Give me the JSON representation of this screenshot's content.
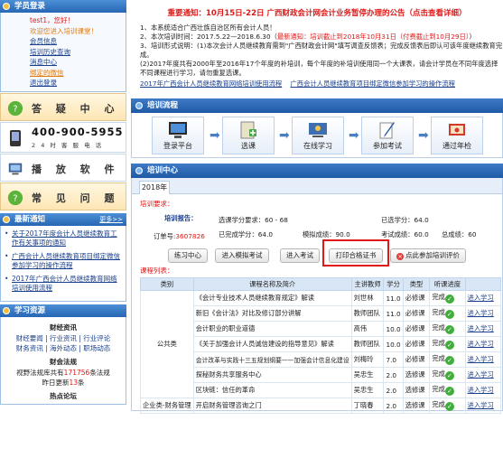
{
  "sidebar": {
    "login_title": "学员登录",
    "user_greeting": "test1，您好！",
    "welcome": "欢迎您进入培训课堂！",
    "menu": [
      "会员信息",
      "培训历史查询",
      "消息中心",
      "绑定的微信",
      "退出登录"
    ],
    "qa_label": "答 疑 中 心",
    "phone": "400-900-5955",
    "phone_sub": "2 4 时 客 服 电 话",
    "software_label": "播 放 软 件",
    "faq_label": "常 见 问 题",
    "news_title": "最新通知",
    "news_more": "更多>>",
    "news": [
      "关于2017年度会计人员继续教育工作有关事项的通知",
      "广西会计人员继续教育项目绑定微信参加学习的操作流程",
      "2017年广西会计人员继续教育网络培训使用流程"
    ],
    "resources_title": "学习资源",
    "res_finance_title": "财经资讯",
    "res_finance_links": [
      "财经要闻 | 行业资讯 | 行业评论",
      "财务资讯 | 海外动态 | 职场动态"
    ],
    "res_law_title": "财会法规",
    "res_law_text_a": "视野法规库共有",
    "res_law_count": "171756",
    "res_law_text_b": "条法规",
    "res_law_updated_a": "昨日更新",
    "res_law_updated_count": "13",
    "res_law_updated_b": "条",
    "res_forum_title": "热点论坛"
  },
  "main": {
    "announcement": "重要通知：10月15日-22日 广西财政会计网会计业务暂停办理的公告（点击查看详细）",
    "info": [
      "1、本系统适合广西壮族自治区所有会计人员！",
      "2、本次培训时间：2017.5.22—2018.6.30（",
      "3、培训形式说明：(1)本次会计人员继续教育需到\"广西财政会计网\"填写调查反馈表；完成反馈表后即认可该年度继续教育完成。",
      "(2)2017年度共有2000年至2016年17个年度的补培训，每个年度的补培训使用同一个大课表，请会计学员在不同年度选择不同课程进行学习，请勿重复选课。"
    ],
    "info_highlight": "最新通知：培训截止到2018年10月31日（付费截止到10月29日）",
    "info_tail": "）",
    "link1": "2017年广西会计人员继续教育网络培训使用流程",
    "link2": "广西会计人员继续教育项目绑定微信参加学习的操作流程",
    "flow_title": "培训流程",
    "flow_steps": [
      "登录平台",
      "选课",
      "在线学习",
      "参加考试",
      "通过年检"
    ],
    "center_title": "培训中心",
    "year_tab": "2018年",
    "req_label": "培训要求：",
    "report_label": "培训报告：",
    "order_label": "订单号:",
    "order_no": "3607826",
    "stats": {
      "required_label": "选课学分要求：",
      "required_val": "60 - 68",
      "selected_label": "已选学分：",
      "selected_val": "64.0",
      "done_label": "已完成学分：",
      "done_val": "64.0",
      "mock_label": "模拟成绩：",
      "mock_val": "90.0",
      "exam_label": "考试成绩：",
      "exam_val": "60.0",
      "total_label": "总成绩：",
      "total_val": "60"
    },
    "buttons": [
      "练习中心",
      "进入模拟考试",
      "进入考试",
      "打印合格证书",
      "点此参加培训评价"
    ],
    "courses_label": "课程列表：",
    "table_headers": [
      "类别",
      "课程名称及简介",
      "主讲教师",
      "学分",
      "类型",
      "听课进度",
      ""
    ],
    "category": "公共类",
    "courses": [
      {
        "name": "《会计专业技术人员继续教育规定》解读",
        "teacher": "刘世林",
        "credit": "11.0",
        "type": "必修课",
        "status": "完成",
        "action": "进入学习"
      },
      {
        "name": "新旧《会计法》对比及修订部分讲解",
        "teacher": "教师团队",
        "credit": "11.0",
        "type": "必修课",
        "status": "完成",
        "action": "进入学习"
      },
      {
        "name": "会计职业的职业道德",
        "teacher": "高伟",
        "credit": "10.0",
        "type": "必修课",
        "status": "完成",
        "action": "进入学习"
      },
      {
        "name": "《关于加强会计人员诚信建设的指导意见》解读",
        "teacher": "教师团队",
        "credit": "10.0",
        "type": "必修课",
        "status": "完成",
        "action": "进入学习"
      },
      {
        "name": "会计改革与实践十三五规划纲要——加强会计信息化建设",
        "teacher": "刘梅玲",
        "credit": "7.0",
        "type": "必修课",
        "status": "完成",
        "action": "进入学习"
      },
      {
        "name": "探秘财务共享服务中心",
        "teacher": "吴忠生",
        "credit": "2.0",
        "type": "选修课",
        "status": "完成",
        "action": "进入学习"
      },
      {
        "name": "区块链：信任的革命",
        "teacher": "吴忠生",
        "credit": "2.0",
        "type": "选修课",
        "status": "完成",
        "action": "进入学习"
      }
    ],
    "last_category": "企业类-财务管理",
    "last_course": {
      "name": "开启财务管理咨询之门",
      "teacher": "丁晓春",
      "credit": "2.0",
      "type": "选修课",
      "status": "完成",
      "action": "进入学习"
    }
  }
}
